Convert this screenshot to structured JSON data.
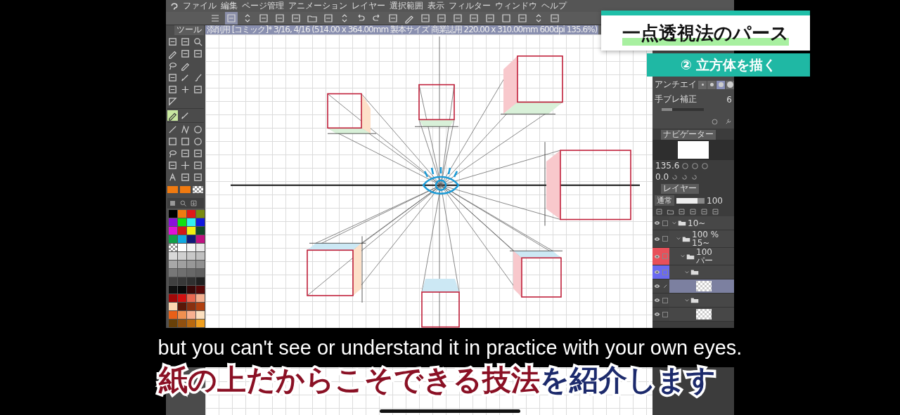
{
  "menu": [
    "ファイル",
    "編集",
    "ページ管理",
    "アニメーション",
    "レイヤー",
    "選択範囲",
    "表示",
    "フィルター",
    "ウィンドウ",
    "ヘルプ"
  ],
  "document_tab": "添削用 [コミック]* 3/16, 4/16 (514.00 x 364.00mm 製本サイズ 商業誌用 220.00 x 310.00mm 600dpi 135.6%)",
  "tool_panel": {
    "tab": "ツール"
  },
  "color_swatches": [
    {
      "kind": "solid",
      "color": "#f07a10"
    },
    {
      "kind": "solid",
      "color": "#f07a10"
    },
    {
      "kind": "transparent"
    }
  ],
  "palette": [
    {
      "kind": "solid",
      "color": "#000000"
    },
    {
      "kind": "solid",
      "color": "#f07a10"
    },
    {
      "kind": "solid",
      "color": "#e01818"
    },
    {
      "kind": "solid",
      "color": "#7a8a10"
    },
    {
      "kind": "solid",
      "color": "#8a10d8"
    },
    {
      "kind": "solid",
      "color": "#10e010"
    },
    {
      "kind": "solid",
      "color": "#30f0f0"
    },
    {
      "kind": "solid",
      "color": "#1018e0"
    },
    {
      "kind": "solid",
      "color": "#e010d8"
    },
    {
      "kind": "solid",
      "color": "#d01818"
    },
    {
      "kind": "solid",
      "color": "#f0f010"
    },
    {
      "kind": "solid",
      "color": "#104828"
    },
    {
      "kind": "solid",
      "color": "#10a048"
    },
    {
      "kind": "solid",
      "color": "#10a8e0"
    },
    {
      "kind": "solid",
      "color": "#101878"
    },
    {
      "kind": "solid",
      "color": "#c01080"
    },
    {
      "kind": "transparent"
    },
    {
      "kind": "solid",
      "color": "#ffffff"
    },
    {
      "kind": "solid",
      "color": "#f4f4f4"
    },
    {
      "kind": "solid",
      "color": "#e8e8e8"
    },
    {
      "kind": "solid",
      "color": "#d8d8d8"
    },
    {
      "kind": "solid",
      "color": "#d0d0d0"
    },
    {
      "kind": "solid",
      "color": "#c8c8c8"
    },
    {
      "kind": "solid",
      "color": "#c0c0c0"
    },
    {
      "kind": "solid",
      "color": "#a8a8a8"
    },
    {
      "kind": "solid",
      "color": "#a0a0a0"
    },
    {
      "kind": "solid",
      "color": "#989898"
    },
    {
      "kind": "solid",
      "color": "#909090"
    },
    {
      "kind": "solid",
      "color": "#787878"
    },
    {
      "kind": "solid",
      "color": "#707070"
    },
    {
      "kind": "solid",
      "color": "#686868"
    },
    {
      "kind": "solid",
      "color": "#606060"
    },
    {
      "kind": "solid",
      "color": "#404040"
    },
    {
      "kind": "solid",
      "color": "#383838"
    },
    {
      "kind": "solid",
      "color": "#303030"
    },
    {
      "kind": "solid",
      "color": "#202020"
    },
    {
      "kind": "solid",
      "color": "#101010"
    },
    {
      "kind": "solid",
      "color": "#080808"
    },
    {
      "kind": "solid",
      "color": "#380808"
    },
    {
      "kind": "solid",
      "color": "#580808"
    },
    {
      "kind": "solid",
      "color": "#a00808"
    },
    {
      "kind": "solid",
      "color": "#d01010"
    },
    {
      "kind": "solid",
      "color": "#e86850"
    },
    {
      "kind": "solid",
      "color": "#f4b090"
    },
    {
      "kind": "solid",
      "color": "#fcd8b0"
    },
    {
      "kind": "solid",
      "color": "#581808"
    },
    {
      "kind": "solid",
      "color": "#883010"
    },
    {
      "kind": "solid",
      "color": "#b04010"
    },
    {
      "kind": "solid",
      "color": "#e86018"
    },
    {
      "kind": "solid",
      "color": "#f09050"
    },
    {
      "kind": "solid",
      "color": "#f8b090"
    },
    {
      "kind": "solid",
      "color": "#fce0c0"
    },
    {
      "kind": "solid",
      "color": "#684008"
    },
    {
      "kind": "solid",
      "color": "#905010"
    },
    {
      "kind": "solid",
      "color": "#b86810"
    },
    {
      "kind": "solid",
      "color": "#f0a020"
    }
  ],
  "tool_property": {
    "antialias_label": "アンチエイ",
    "antialias_options": [
      {
        "selected": false
      },
      {
        "selected": false
      },
      {
        "selected": true
      },
      {
        "selected": false
      }
    ],
    "stabilization": {
      "label": "手ブレ補正",
      "value": "6",
      "level": 0.25
    }
  },
  "navigator": {
    "tab": "ナビゲーター",
    "zoom": "135.6",
    "rotation": "0.0"
  },
  "layer_panel": {
    "tab": "レイヤー",
    "blend_mode": "通常",
    "opacity_slider": {
      "level": 0.75
    },
    "opacity": "100"
  },
  "layers": [
    {
      "lines": [
        "10~"
      ],
      "kind": "folder",
      "expanded": true,
      "selected": false,
      "children": [
        {
          "lines": [
            "100 %",
            "15~"
          ],
          "kind": "folder",
          "expanded": true,
          "selected": false,
          "children": [
            {
              "lines": [
                "100",
                "パー"
              ],
              "kind": "folder",
              "expanded": true,
              "selected": false,
              "color": "#e8505a",
              "children": [
                {
                  "kind": "folder",
                  "expanded": true,
                  "selected": false,
                  "color": "#6a6af0",
                  "children": [
                    {
                      "kind": "raster",
                      "selected": true
                    }
                  ]
                },
                {
                  "kind": "folder",
                  "expanded": true,
                  "selected": false,
                  "children": [
                    {
                      "kind": "raster",
                      "selected": false
                    }
                  ]
                }
              ]
            }
          ]
        }
      ]
    }
  ],
  "title_card": "一点透視法のパース",
  "subtitle_card": "② 立方体を描く",
  "caption": "but you can't see or understand it in practice with your own eyes.",
  "caption_jp": [
    {
      "text": "紙の上だからこそできる技法",
      "color": "#8a1024"
    },
    {
      "text": "を紹介します",
      "color": "#1c2a6c"
    }
  ]
}
